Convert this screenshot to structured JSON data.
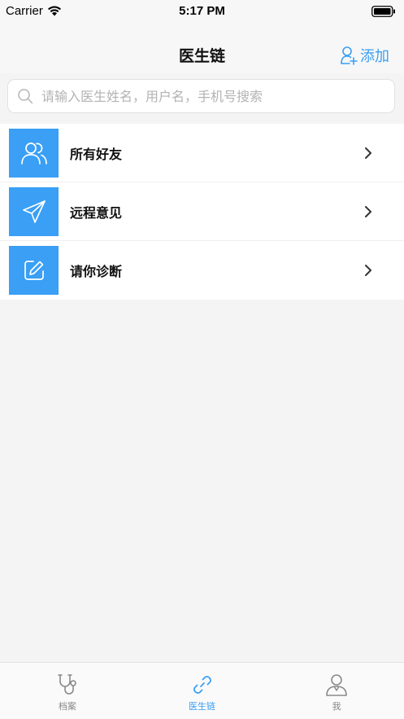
{
  "status_bar": {
    "carrier": "Carrier",
    "time": "5:17 PM"
  },
  "nav": {
    "title": "医生链",
    "add_label": "添加"
  },
  "search": {
    "placeholder": "请输入医生姓名，用户名，手机号搜索"
  },
  "menu": {
    "items": [
      {
        "label": "所有好友",
        "icon": "users-icon"
      },
      {
        "label": "远程意见",
        "icon": "paper-plane-icon"
      },
      {
        "label": "请你诊断",
        "icon": "edit-icon"
      }
    ]
  },
  "tabs": {
    "items": [
      {
        "label": "档案",
        "icon": "stethoscope-icon",
        "active": false
      },
      {
        "label": "医生链",
        "icon": "link-icon",
        "active": true
      },
      {
        "label": "我",
        "icon": "user-icon",
        "active": false
      }
    ]
  },
  "colors": {
    "accent": "#3a9ff5",
    "background": "#f4f4f4",
    "inactive": "#888888"
  }
}
